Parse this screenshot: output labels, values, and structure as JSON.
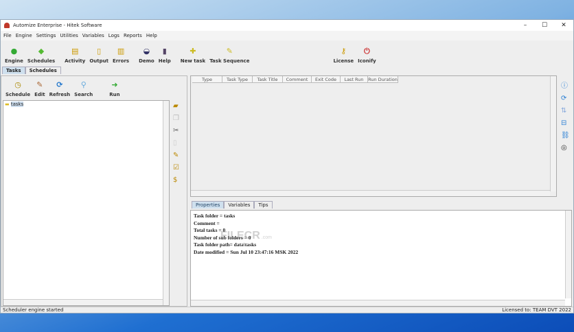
{
  "window": {
    "title": "Automize Enterprise   - Hitek Software"
  },
  "menu": [
    "File",
    "Engine",
    "Settings",
    "Utilities",
    "Variables",
    "Logs",
    "Reports",
    "Help"
  ],
  "toolbar": {
    "groups": [
      [
        {
          "label": "Engine",
          "icon": "green-circle-icon",
          "g": "●",
          "c": "#3a3"
        },
        {
          "label": "Schedules",
          "icon": "green-diamond-icon",
          "g": "◆",
          "c": "#5b3"
        }
      ],
      [
        {
          "label": "Activity",
          "icon": "notepad-icon",
          "g": "▤",
          "c": "#c90"
        },
        {
          "label": "Output",
          "icon": "document-icon",
          "g": "▯",
          "c": "#c90"
        },
        {
          "label": "Errors",
          "icon": "error-doc-icon",
          "g": "▥",
          "c": "#c90"
        }
      ],
      [
        {
          "label": "Demo",
          "icon": "demo-icon",
          "g": "◒",
          "c": "#336"
        },
        {
          "label": "Help",
          "icon": "help-book-icon",
          "g": "▮",
          "c": "#546"
        }
      ],
      [
        {
          "label": "New task",
          "icon": "new-task-icon",
          "g": "✚",
          "c": "#cb2"
        },
        {
          "label": "Task Sequence",
          "icon": "task-sequence-icon",
          "g": "✎",
          "c": "#cb2"
        }
      ]
    ],
    "right": [
      {
        "label": "License",
        "icon": "key-icon",
        "g": "⚷",
        "c": "#c90"
      },
      {
        "label": "Iconify",
        "icon": "iconify-icon",
        "g": "⏻",
        "c": "#c33"
      }
    ]
  },
  "tabs": [
    "Tasks",
    "Schedules"
  ],
  "left_toolbar": [
    {
      "label": "Schedule",
      "g": "◷",
      "c": "#a80"
    },
    {
      "label": "Edit",
      "g": "✎",
      "c": "#a63"
    },
    {
      "label": "Refresh",
      "g": "⟳",
      "c": "#27c"
    },
    {
      "label": "Search",
      "g": "⚲",
      "c": "#6ad"
    },
    {
      "label": "Run",
      "g": "➜",
      "c": "#3a3"
    }
  ],
  "tree": {
    "root": "tasks"
  },
  "table": {
    "columns": [
      "Type",
      "Task Type",
      "Task Title",
      "Comment",
      "Exit Code",
      "Last Run",
      "Run Duration"
    ]
  },
  "bottom_tabs": [
    "Properties",
    "Variables",
    "Tips"
  ],
  "properties": [
    "Task folder = tasks",
    "Comment =",
    "Total tasks = 0",
    "Number of sub folders = 0",
    "Task folder path= data\\tasks",
    "Date modified = Sun Jul 10 23:47:16 MSK 2022"
  ],
  "watermark": {
    "text": "FILECR",
    "suffix": ".com"
  },
  "status": {
    "left": "Scheduler engine started",
    "right": "Licensed to: TEAM DVT 2022"
  }
}
